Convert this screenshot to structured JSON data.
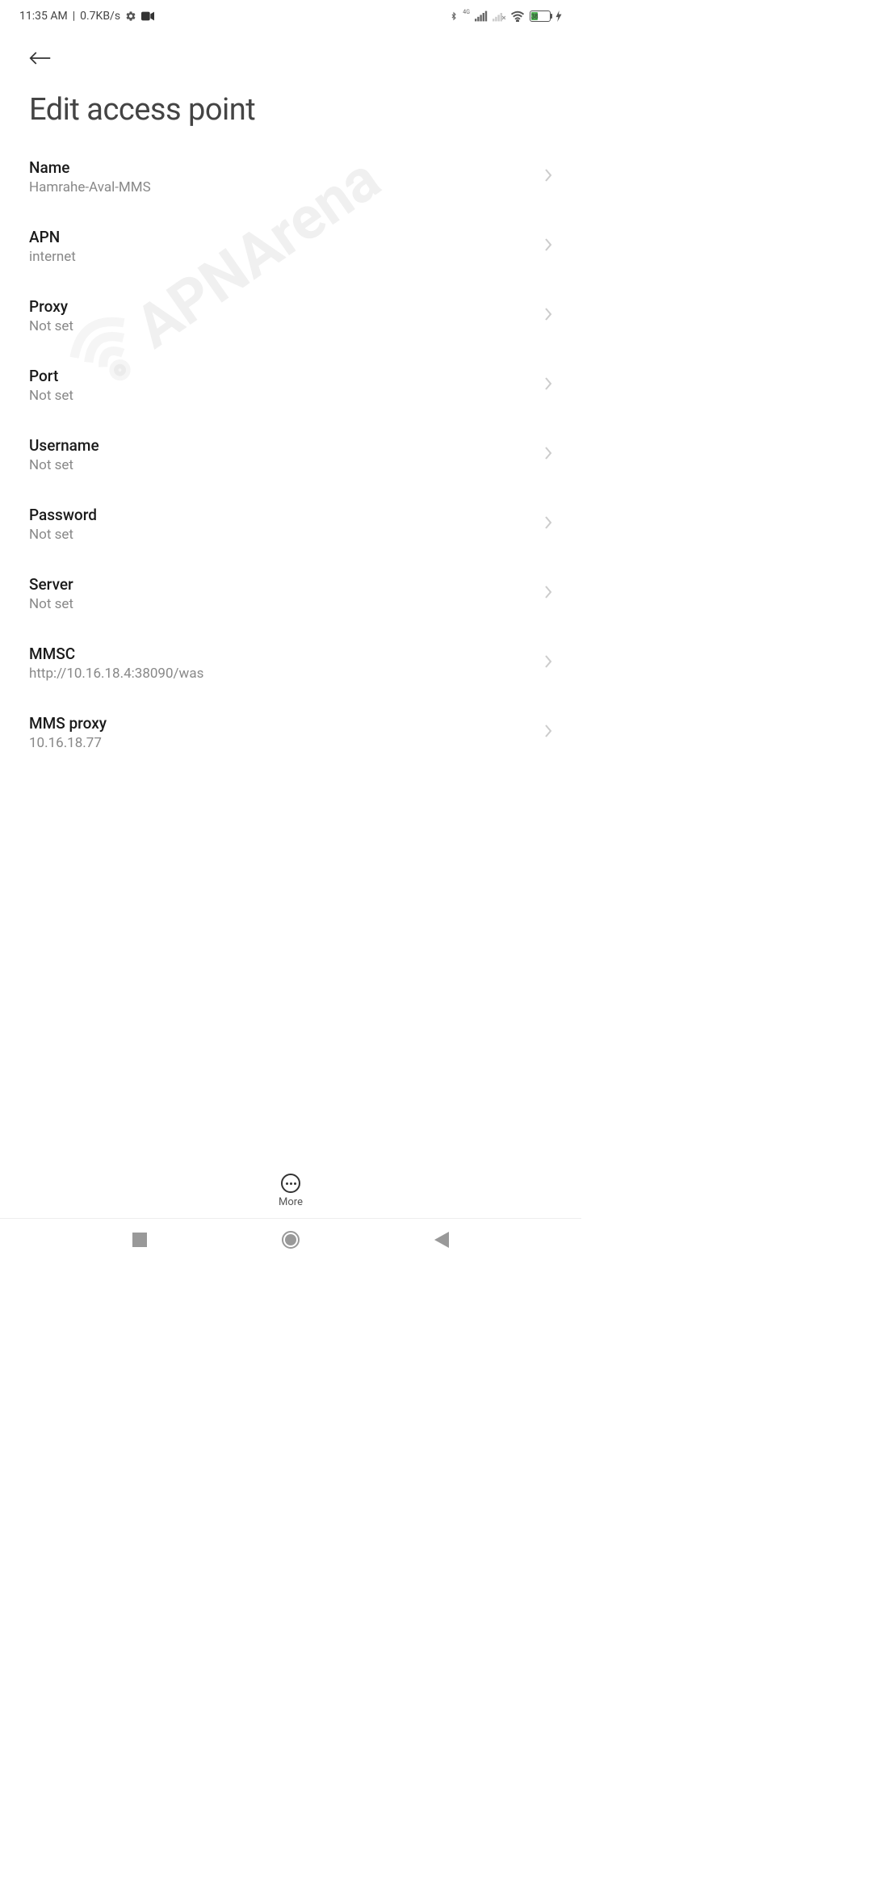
{
  "status": {
    "time": "11:35 AM",
    "separator": "|",
    "data_speed": "0.7KB/s",
    "battery_pct": "38",
    "network_label": "4G"
  },
  "page": {
    "title": "Edit access point"
  },
  "settings": [
    {
      "label": "Name",
      "value": "Hamrahe-Aval-MMS"
    },
    {
      "label": "APN",
      "value": "internet"
    },
    {
      "label": "Proxy",
      "value": "Not set"
    },
    {
      "label": "Port",
      "value": "Not set"
    },
    {
      "label": "Username",
      "value": "Not set"
    },
    {
      "label": "Password",
      "value": "Not set"
    },
    {
      "label": "Server",
      "value": "Not set"
    },
    {
      "label": "MMSC",
      "value": "http://10.16.18.4:38090/was"
    },
    {
      "label": "MMS proxy",
      "value": "10.16.18.77"
    }
  ],
  "actions": {
    "more": "More"
  },
  "watermark": "APNArena"
}
